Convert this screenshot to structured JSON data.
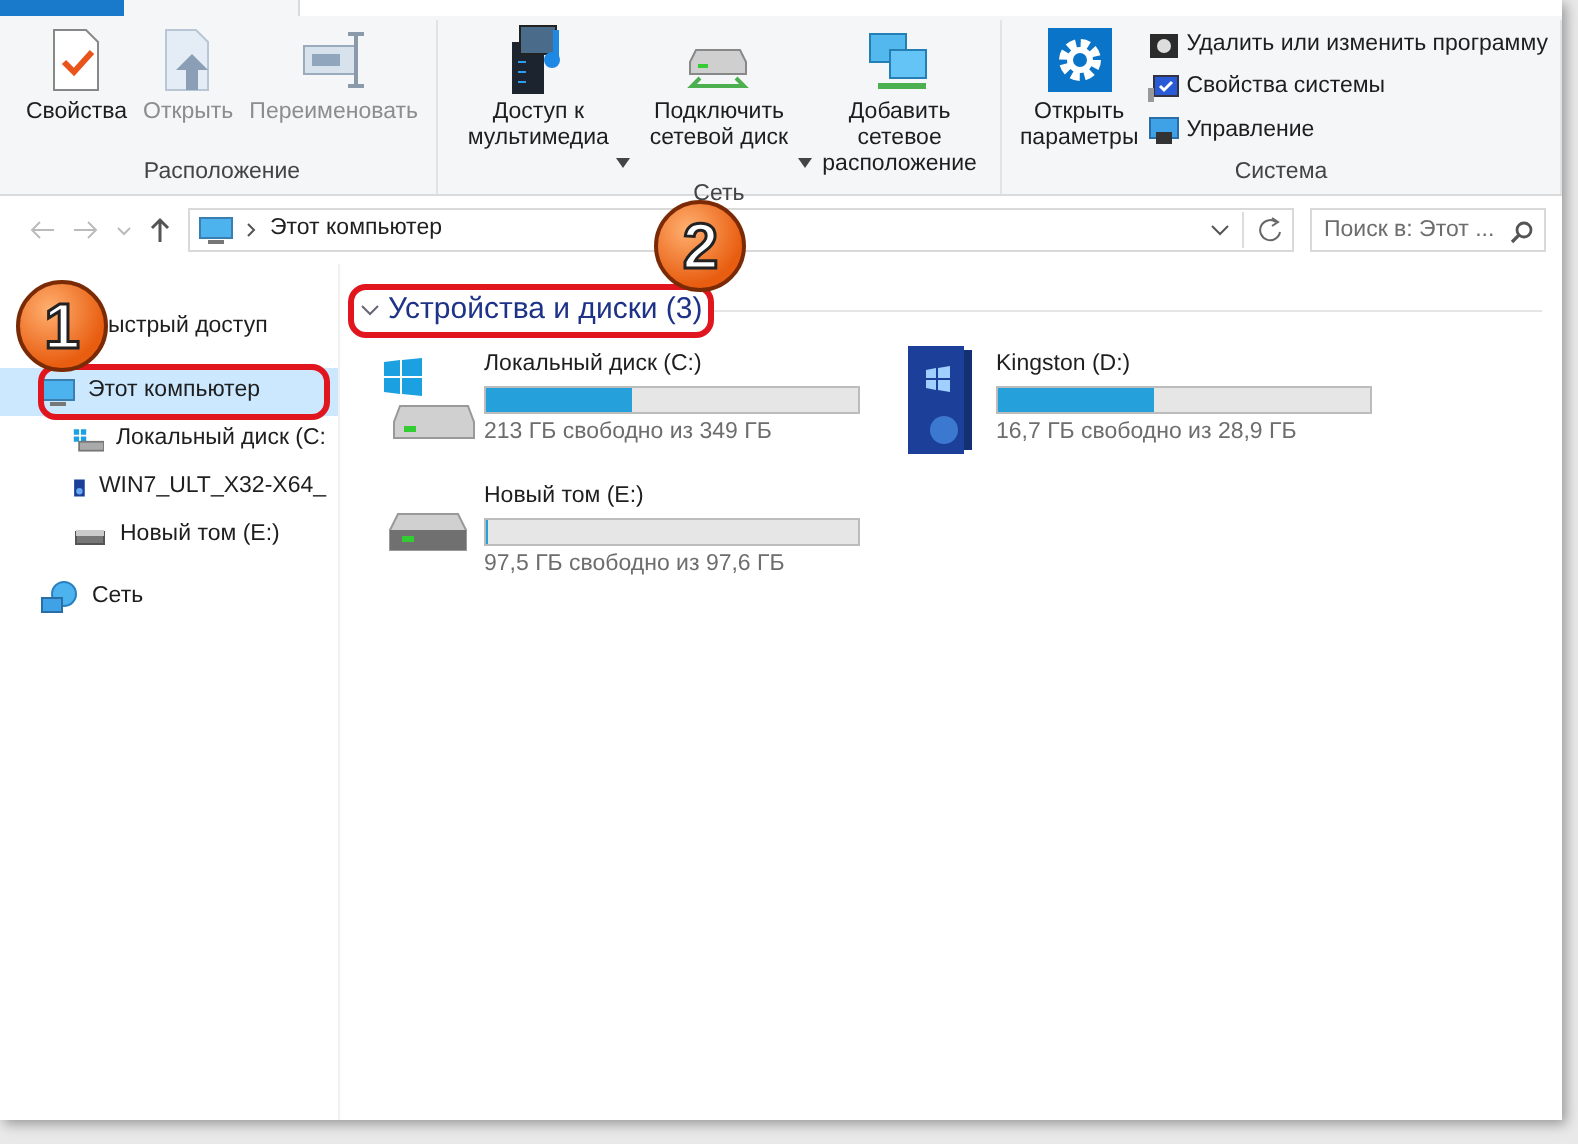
{
  "ribbon": {
    "groups": [
      {
        "label": "Расположение",
        "large": [
          {
            "kind": "properties",
            "label": "Свойства",
            "disabled": false,
            "dropdown": false
          },
          {
            "kind": "open",
            "label": "Открыть",
            "disabled": true,
            "dropdown": false
          },
          {
            "kind": "rename",
            "label": "Переименовать",
            "disabled": true,
            "dropdown": false
          }
        ]
      },
      {
        "label": "Сеть",
        "large": [
          {
            "kind": "media",
            "label": "Доступ к мультимедиа",
            "disabled": false,
            "dropdown": true
          },
          {
            "kind": "netdrive",
            "label": "Подключить сетевой диск",
            "disabled": false,
            "dropdown": true
          },
          {
            "kind": "netloc",
            "label": "Добавить сетевое расположение",
            "disabled": false,
            "dropdown": false
          }
        ]
      },
      {
        "label": "Система",
        "large": [
          {
            "kind": "settings",
            "label": "Открыть параметры",
            "disabled": false,
            "dropdown": false
          }
        ],
        "small": [
          {
            "kind": "uninstall",
            "label": "Удалить или изменить программу"
          },
          {
            "kind": "sysprops",
            "label": "Свойства системы"
          },
          {
            "kind": "manage",
            "label": "Управление"
          }
        ]
      }
    ]
  },
  "address": {
    "path": "Этот компьютер",
    "search_placeholder": "Поиск в: Этот ..."
  },
  "sidebar": [
    {
      "kind": "quick",
      "label": "ыстрый доступ",
      "selected": false
    },
    {
      "kind": "pc",
      "label": "Этот компьютер",
      "selected": true,
      "children": [
        {
          "kind": "windisk",
          "label": "Локальный диск (C:",
          "selected": false
        },
        {
          "kind": "dvd",
          "label": "WIN7_ULT_X32-X64_",
          "selected": false
        },
        {
          "kind": "disk",
          "label": "Новый том (E:)",
          "selected": false
        }
      ]
    },
    {
      "kind": "network",
      "label": "Сеть",
      "selected": false
    }
  ],
  "section": {
    "title": "Устройства и диски (3)",
    "expanded": true
  },
  "drives": [
    {
      "kind": "windisk",
      "name": "Локальный диск (C:)",
      "level": 0.39,
      "free": "213 ГБ свободно из 349 ГБ"
    },
    {
      "kind": "dvd",
      "name": "Kingston (D:)",
      "level": 0.42,
      "free": "16,7 ГБ свободно из 28,9 ГБ"
    },
    {
      "kind": "disk",
      "name": "Новый том (E:)",
      "level": 0.001,
      "free": "97,5 ГБ свободно из 97,6 ГБ"
    }
  ],
  "annotations": [
    {
      "label": "1",
      "kind": "sidebar"
    },
    {
      "label": "2",
      "kind": "section"
    }
  ]
}
